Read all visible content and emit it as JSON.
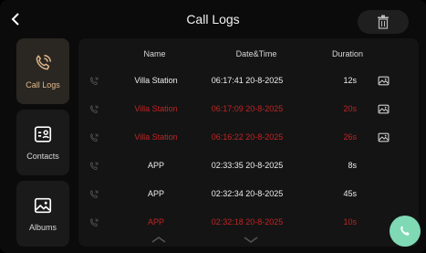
{
  "header": {
    "title": "Call Logs"
  },
  "sidebar": {
    "items": [
      {
        "label": "Call Logs",
        "icon": "phone-icon",
        "active": true
      },
      {
        "label": "Contacts",
        "icon": "contact-card-icon",
        "active": false
      },
      {
        "label": "Albums",
        "icon": "image-icon",
        "active": false
      }
    ]
  },
  "table": {
    "columns": [
      "Name",
      "Date&Time",
      "Duration"
    ],
    "rows": [
      {
        "name": "Villa Station",
        "datetime": "06:17:41 20-8-2025",
        "duration": "12s",
        "missed": false,
        "has_image": true
      },
      {
        "name": "Villa Station",
        "datetime": "06:17:09 20-8-2025",
        "duration": "20s",
        "missed": true,
        "has_image": true
      },
      {
        "name": "Villa Station",
        "datetime": "06:16:22 20-8-2025",
        "duration": "26s",
        "missed": true,
        "has_image": true
      },
      {
        "name": "APP",
        "datetime": "02:33:35 20-8-2025",
        "duration": "8s",
        "missed": false,
        "has_image": false
      },
      {
        "name": "APP",
        "datetime": "02:32:34 20-8-2025",
        "duration": "45s",
        "missed": false,
        "has_image": false
      },
      {
        "name": "APP",
        "datetime": "02:32:18 20-8-2025",
        "duration": "10s",
        "missed": true,
        "has_image": false
      }
    ]
  },
  "colors": {
    "missed": "#c02424",
    "accent": "#e0b888",
    "call_button": "#7fd9b5"
  }
}
